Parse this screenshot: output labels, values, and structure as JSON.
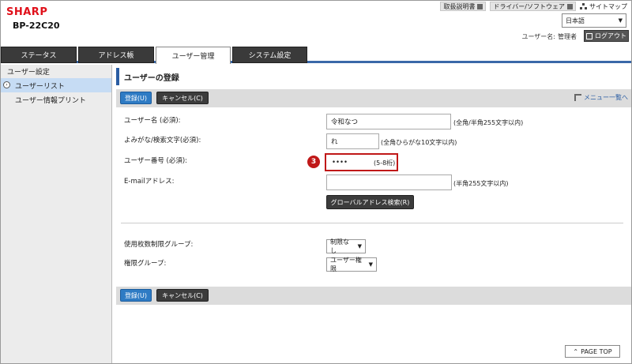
{
  "header": {
    "brand": "SHARP",
    "model": "BP-22C20",
    "links": [
      "取扱説明書",
      "ドライバー/ソフトウェア",
      "サイトマップ"
    ],
    "language": "日本語",
    "user_label": "ユーザー名:",
    "user_name": "管理者",
    "logout": "ログアウト"
  },
  "tabs": [
    "ステータス",
    "アドレス帳",
    "ユーザー管理",
    "システム設定"
  ],
  "sidebar": {
    "heading": "ユーザー設定",
    "items": [
      {
        "label": "ユーザーリスト"
      },
      {
        "label": "ユーザー情報プリント"
      }
    ]
  },
  "main": {
    "title": "ユーザーの登録",
    "register": "登録(U)",
    "cancel": "キャンセル(C)",
    "menu_link": "メニュー一覧へ",
    "fields": {
      "username_label": "ユーザー名 (必須):",
      "username_value": "令和なつ",
      "username_hint": "(全角/半角255文字以内)",
      "kana_label": "よみがな/検索文字(必須):",
      "kana_value": "れ",
      "kana_hint": "(全角ひらがな10文字以内)",
      "number_label": "ユーザー番号 (必須):",
      "number_value": "••••",
      "number_hint": "(5-8桁)",
      "step": "3",
      "email_label": "E-mailアドレス:",
      "email_value": "",
      "email_hint": "(半角255文字以内)",
      "global_search": "グローバルアドレス検索(R)"
    },
    "groups": {
      "limit_label": "使用枚数制限グループ:",
      "limit_value": "制限なし",
      "auth_label": "権限グループ:",
      "auth_value": "ユーザー権限"
    },
    "page_top": "PAGE TOP"
  }
}
